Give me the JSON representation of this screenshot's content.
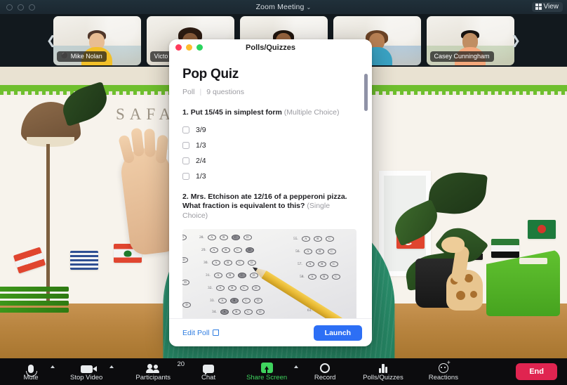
{
  "titlebar": {
    "title": "Zoom Meeting",
    "caret": "⌄",
    "view_label": "View",
    "view_icon": "grid-icon"
  },
  "filmstrip": {
    "prev_icon": "chevron-left-icon",
    "next_icon": "chevron-right-icon",
    "participants": [
      {
        "name": "Mike Nolan",
        "muted": true
      },
      {
        "name": "Victo",
        "muted": false
      },
      {
        "name": "",
        "muted": false
      },
      {
        "name": "",
        "muted": false
      },
      {
        "name": "Casey Cunningham",
        "muted": false
      }
    ]
  },
  "stage": {
    "background_text": "SAFARI"
  },
  "dialog": {
    "window_title": "Polls/Quizzes",
    "traffic_lights": [
      "close-red",
      "minimize-yellow",
      "zoom-green"
    ],
    "quiz_title": "Pop Quiz",
    "meta_type": "Poll",
    "meta_separator": "|",
    "meta_count": "9 questions",
    "questions": [
      {
        "number": "1.",
        "text": "Put 15/45 in simplest form",
        "type": "(Multiple Choice)",
        "options": [
          "3/9",
          "1/3",
          "2/4",
          "1/3"
        ]
      },
      {
        "number": "2.",
        "text": "Mrs. Etchison ate 12/16 of a pepperoni pizza. What fraction is equivalent to this?",
        "type": "(Single Choice)",
        "image_alt": "scantron-answer-sheet-with-pencil",
        "options": []
      }
    ],
    "footer": {
      "edit_label": "Edit Poll",
      "edit_icon": "external-link-icon",
      "launch_label": "Launch",
      "launch_color": "#2d6ff5"
    }
  },
  "toolbar": {
    "items": [
      {
        "label": "Mute",
        "icon": "microphone-icon",
        "caret": true
      },
      {
        "label": "Stop Video",
        "icon": "camera-icon",
        "caret": true
      },
      {
        "label": "Participants",
        "icon": "people-icon",
        "count": "20"
      },
      {
        "label": "Chat",
        "icon": "chat-bubble-icon"
      },
      {
        "label": "Share Screen",
        "icon": "share-screen-icon",
        "caret": true,
        "accent": "#3fd35e"
      },
      {
        "label": "Record",
        "icon": "record-circle-icon"
      },
      {
        "label": "Polls/Quizzes",
        "icon": "bar-chart-icon"
      },
      {
        "label": "Reactions",
        "icon": "smiley-plus-icon"
      }
    ],
    "end_label": "End",
    "end_color": "#e02450"
  }
}
